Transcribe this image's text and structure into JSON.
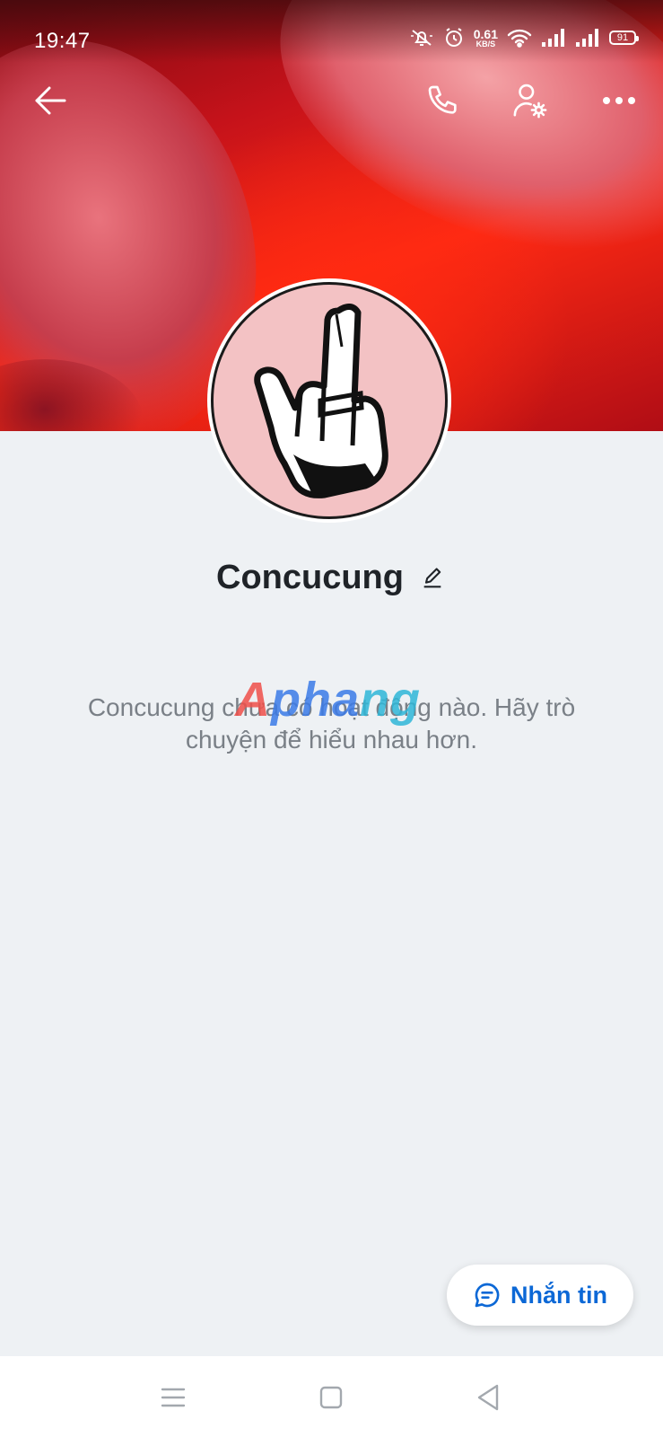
{
  "status_bar": {
    "time": "19:47",
    "net_speed_value": "0.61",
    "net_speed_unit": "KB/S",
    "battery": "91"
  },
  "profile": {
    "name": "Concucung",
    "empty_message": "Concucung chưa có hoạt động nào. Hãy trò chuyện để hiểu nhau hơn."
  },
  "actions": {
    "message_label": "Nhắn tin"
  },
  "watermark": {
    "part1": "A",
    "part2": "pha",
    "part3": "ng"
  },
  "icons": {
    "top_bar": [
      "back-arrow-icon",
      "phone-icon",
      "user-settings-icon",
      "more-icon"
    ],
    "status": [
      "mute-icon",
      "alarm-icon",
      "wifi-icon",
      "signal-icon",
      "battery-icon"
    ],
    "nav_bar": [
      "menu-icon",
      "home-square-icon",
      "back-triangle-icon"
    ]
  },
  "colors": {
    "accent": "#0c68d6",
    "background": "#eef1f4"
  }
}
